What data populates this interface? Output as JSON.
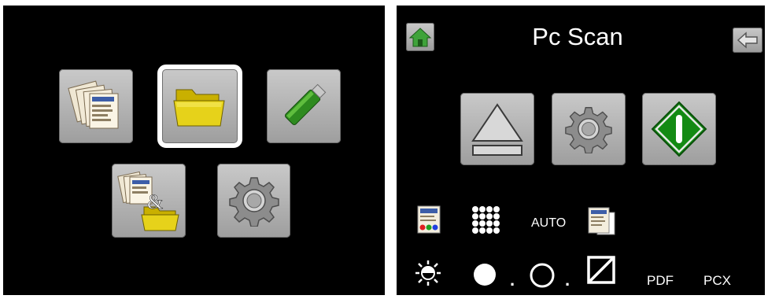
{
  "main_menu": {
    "tiles": [
      {
        "name": "scan-to-pc",
        "icon": "documents-icon"
      },
      {
        "name": "scan-to-folder",
        "icon": "folder-icon",
        "selected": true
      },
      {
        "name": "scan-to-usb",
        "icon": "usb-drive-icon"
      },
      {
        "name": "scan-to-pc-and-folder",
        "icon": "documents-and-folder-icon"
      },
      {
        "name": "settings",
        "icon": "gear-icon"
      }
    ]
  },
  "pc_scan": {
    "title": "Pc Scan",
    "home_icon": "home-icon",
    "back_icon": "back-arrow-icon",
    "actions": [
      {
        "name": "eject",
        "icon": "eject-icon"
      },
      {
        "name": "settings",
        "icon": "gear-icon"
      },
      {
        "name": "start",
        "icon": "start-icon",
        "color": "#138a13"
      }
    ],
    "options_row1": {
      "color_mode_icon": "color-document-icon",
      "resolution_icon": "dot-grid-icon",
      "auto_label": "AUTO",
      "document_type_icon": "document-stack-icon"
    },
    "options_row2": {
      "brightness_icon": "brightness-icon",
      "dot1": ".",
      "dot2": ".",
      "contrast_icon": "contrast-box-icon",
      "pdf_label": "PDF",
      "pcx_label": "PCX"
    }
  }
}
